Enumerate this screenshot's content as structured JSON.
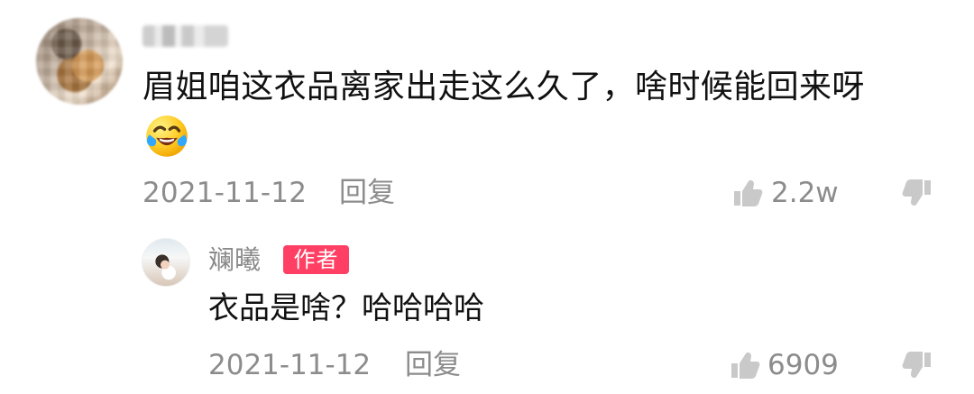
{
  "comment": {
    "text": "眉姐咱这衣品离家出走这么久了，啥时候能回来呀",
    "date": "2021-11-12",
    "reply_label": "回复",
    "likes": "2.2w",
    "emoji_icon": "laughing-crying-emoji-icon"
  },
  "reply": {
    "username": "斓曦",
    "badge": "作者",
    "text": "衣品是啥？哈哈哈哈",
    "date": "2021-11-12",
    "reply_label": "回复",
    "likes": "6909"
  },
  "icons": {
    "like": "thumbs-up-icon",
    "dislike": "thumbs-down-icon"
  },
  "colors": {
    "meta_text": "#8c8c8c",
    "author_badge": "#ff3f63"
  }
}
